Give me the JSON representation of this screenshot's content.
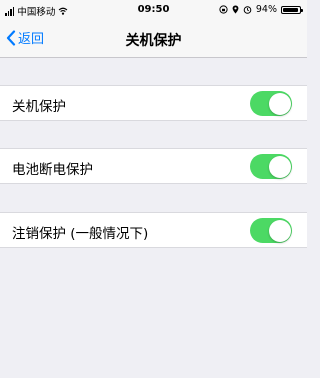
{
  "status_bar": {
    "carrier": "中国移动",
    "time": "09:50",
    "battery_percent": "94%",
    "battery_level": 0.94
  },
  "nav": {
    "back_label": "返回",
    "title": "关机保护"
  },
  "settings": [
    {
      "label": "关机保护",
      "enabled": true
    },
    {
      "label": "电池断电保护",
      "enabled": true
    },
    {
      "label": "注销保护 (一般情况下)",
      "enabled": true
    }
  ],
  "colors": {
    "accent": "#007aff",
    "toggle_on": "#4cd964",
    "background": "#efeff4"
  }
}
